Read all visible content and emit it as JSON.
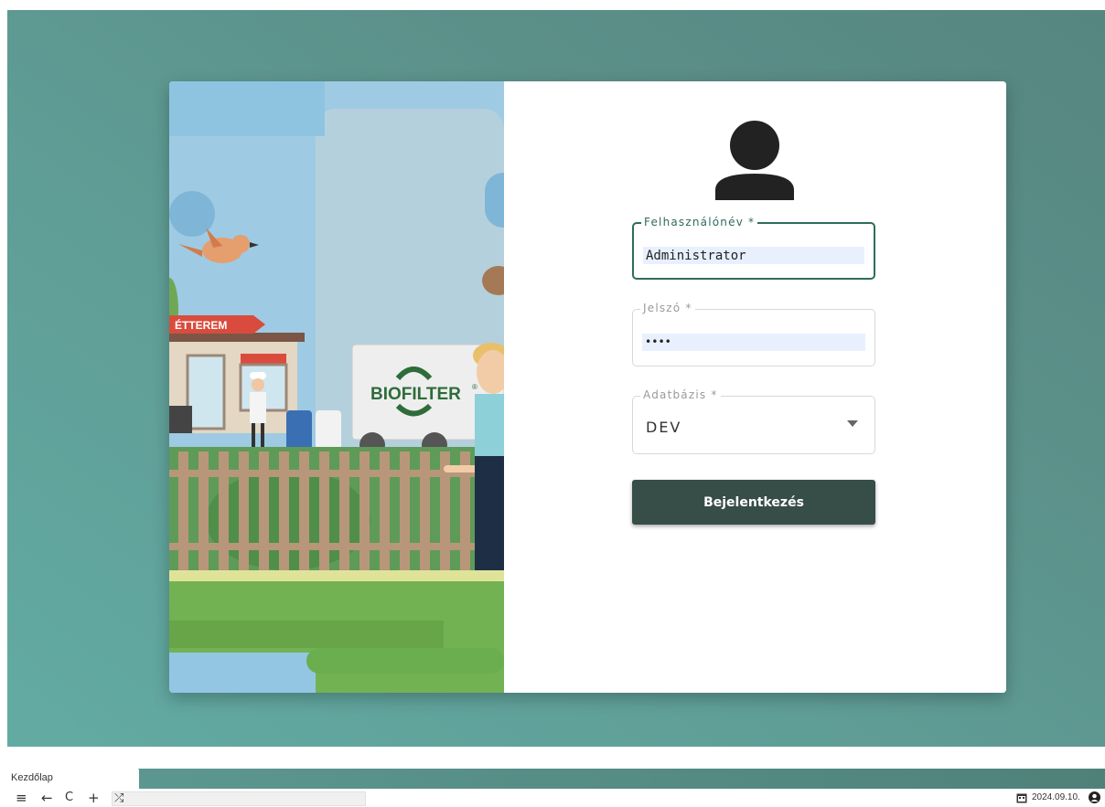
{
  "colors": {
    "background": "#5f9d96",
    "focus_accent": "#2f6b5e",
    "button": "#374d48",
    "autofill": "#e8f0fe"
  },
  "illustration": {
    "restaurant_sign": "ÉTTEREM",
    "truck_brand": "BIOFILTER",
    "truck_registered_mark": "®"
  },
  "login": {
    "avatar_icon": "person-icon",
    "username": {
      "label": "Felhasználónév *",
      "value": "Administrator"
    },
    "password": {
      "label": "Jelszó *",
      "value": "••••"
    },
    "database": {
      "label": "Adatbázis *",
      "value": "DEV",
      "icon": "caret-down-icon"
    },
    "submit_label": "Bejelentkezés"
  },
  "tabs": [
    {
      "label": "Kezdőlap"
    }
  ],
  "toolbar": {
    "menu_icon": "≡",
    "back_icon": "←",
    "reload_icon": "C",
    "add_icon": "+",
    "shuffle_icon": "⤮",
    "address_value": "",
    "date": "2024.09.10."
  }
}
